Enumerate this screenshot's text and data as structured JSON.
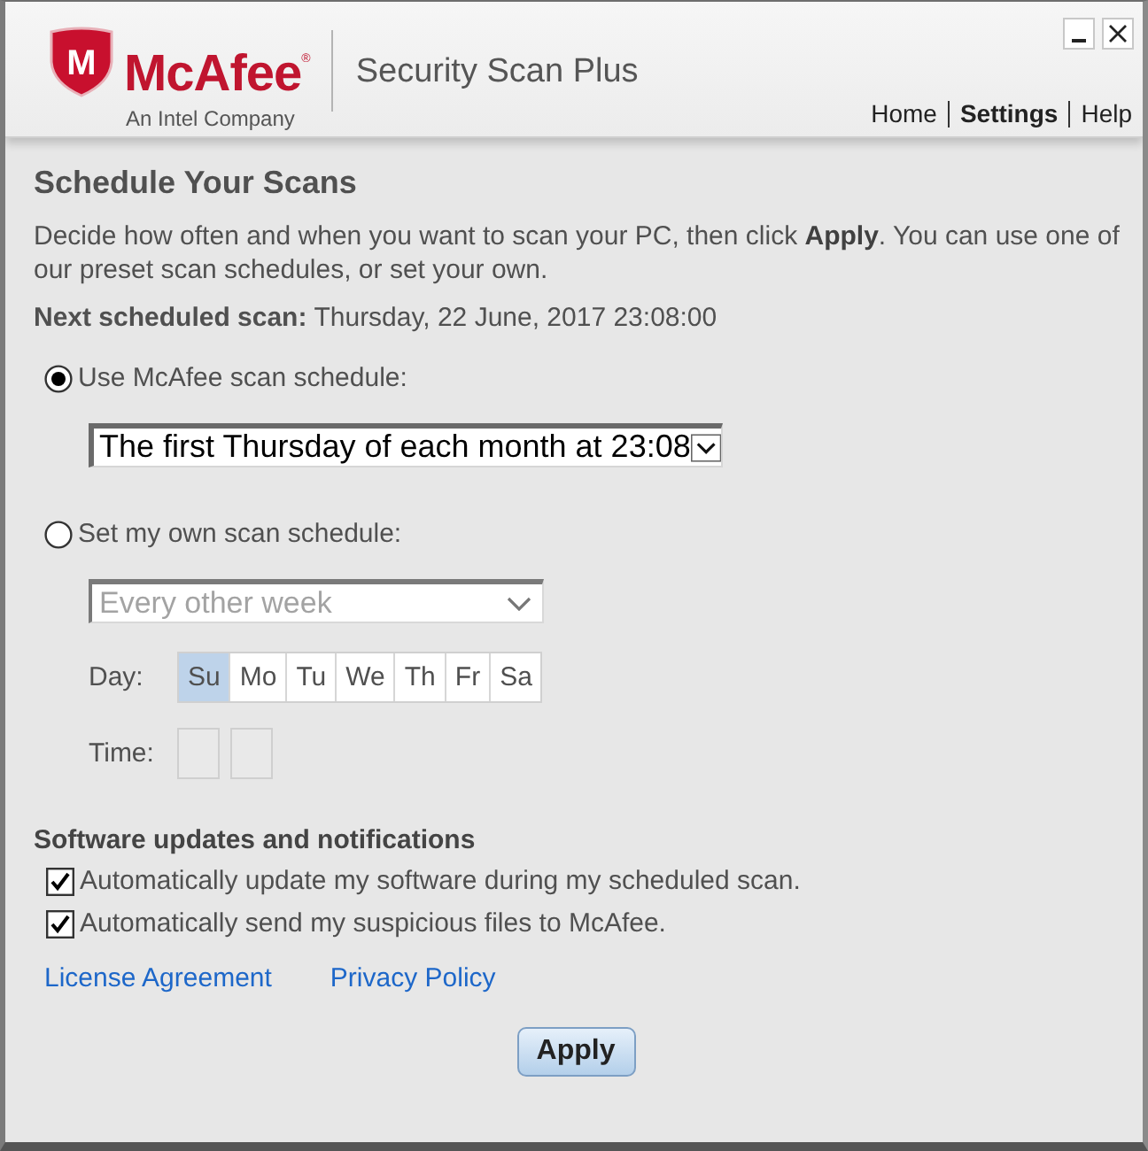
{
  "window": {
    "logo": {
      "mark": "M",
      "brand": "McAfee$^{®}$",
      "tagline": "An Intel Company"
    },
    "product": "Security Scan Plus",
    "nav": [
      {
        "label": "Home",
        "selected": false
      },
      {
        "label": "Settings",
        "selected": true
      },
      {
        "label": "Help",
        "selected": false
      }
    ]
  },
  "schedule": {
    "title": "Schedule Your Scans",
    "intro": "Decide how often and when you want to scan your PC, then click **Apply**. You can use one of our preset scan schedules, or set your own.",
    "next_scan": {
      "label": "Next scheduled scan:",
      "value": "Thursday, 22 June, 2017 23:08:00"
    },
    "options": [
      {
        "label": "Use McAfee scan schedule:",
        "selected": true,
        "dropdown": {
          "value": "The first Thursday of each month at 23:08",
          "disabled": false
        }
      },
      {
        "label": "Set my own scan schedule:",
        "selected": false,
        "dropdown": {
          "value": "Every other week",
          "disabled": true
        },
        "day_label": "Day:",
        "days": [
          {
            "label": "Su",
            "selected": true
          },
          {
            "label": "Mo",
            "selected": false
          },
          {
            "label": "Tu",
            "selected": false
          },
          {
            "label": "We",
            "selected": false
          },
          {
            "label": "Th",
            "selected": false
          },
          {
            "label": "Fr",
            "selected": false
          },
          {
            "label": "Sa",
            "selected": false
          }
        ],
        "time_label": "Time:"
      }
    ]
  },
  "updates": {
    "title": "Software updates and notifications",
    "options": [
      {
        "label": "Automatically update my software during my scheduled scan.",
        "checked": true
      },
      {
        "label": "Automatically send my suspicious files to McAfee.",
        "checked": true
      }
    ]
  },
  "links": [
    "License Agreement",
    "Privacy Policy"
  ],
  "apply_button": "Apply"
}
